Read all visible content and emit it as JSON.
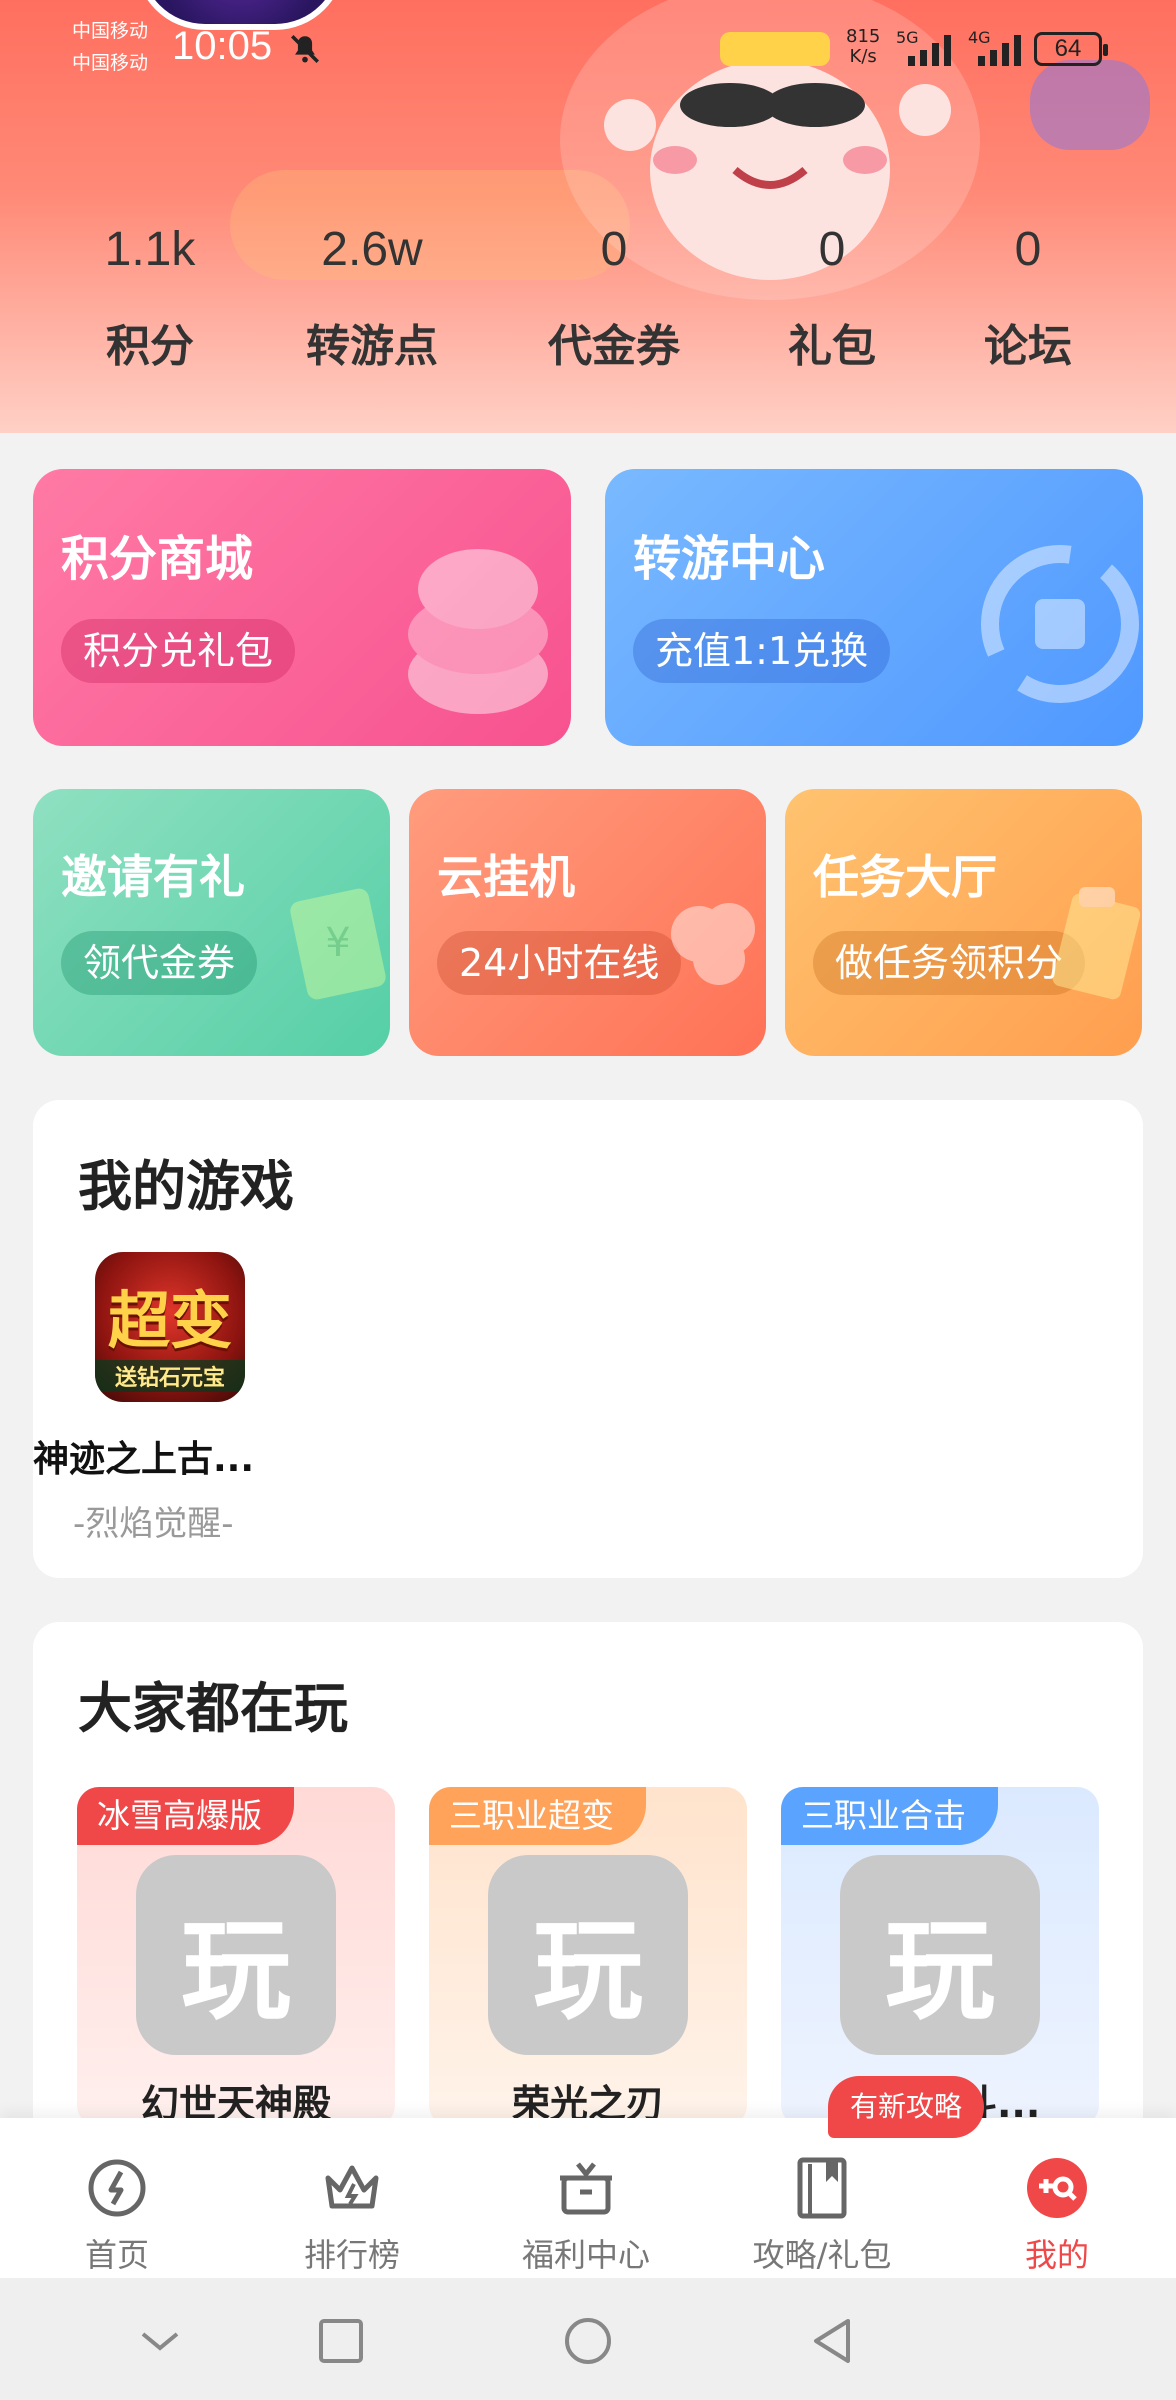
{
  "status_bar": {
    "carrier_1": "中国移动",
    "carrier_2": "中国移动",
    "time": "10:05",
    "net_speed_value": "815",
    "net_speed_unit": "K/s",
    "sig_5g": "5G",
    "sig_4g": "4G",
    "battery": "64",
    "icons": [
      "bell-off-icon",
      "signal-icon",
      "battery-icon"
    ]
  },
  "stats": [
    {
      "value": "1.1k",
      "label": "积分"
    },
    {
      "value": "2.6w",
      "label": "转游点"
    },
    {
      "value": "0",
      "label": "代金券"
    },
    {
      "value": "0",
      "label": "礼包"
    },
    {
      "value": "0",
      "label": "论坛"
    }
  ],
  "feature_cards": {
    "points_mall": {
      "title": "积分商城",
      "subtitle": "积分兑礼包",
      "icon": "coins-icon",
      "color": "#f7528f"
    },
    "transfer_center": {
      "title": "转游中心",
      "subtitle": "充值1:1兑换",
      "icon": "exchange-icon",
      "color": "#5aa3ff"
    },
    "invite": {
      "title": "邀请有礼",
      "subtitle": "领代金券",
      "icon": "voucher-icon",
      "color": "#5fd3ae"
    },
    "cloud_idle": {
      "title": "云挂机",
      "subtitle": "24小时在线",
      "icon": "cloud-icon",
      "color": "#ff7a63"
    },
    "task_hall": {
      "title": "任务大厅",
      "subtitle": "做任务领积分",
      "icon": "task-icon",
      "color": "#ffa75a"
    }
  },
  "my_games": {
    "title": "我的游戏",
    "games": [
      {
        "name": "神迹之上古...",
        "subtitle": "-烈焰觉醒-",
        "icon_text": "超变",
        "icon_sub": "送钻石元宝"
      }
    ]
  },
  "everyone_playing": {
    "title": "大家都在玩",
    "games": [
      {
        "tag": "冰雪高爆版",
        "name": "幻世天神殿",
        "icon_text": "玩",
        "tag_color": "#f04848"
      },
      {
        "tag": "三职业超变",
        "name": "荣光之刃",
        "icon_text": "玩",
        "tag_color": "#ffa25a"
      },
      {
        "tag": "三职业合击",
        "name": "约...（斗...",
        "icon_text": "玩",
        "tag_color": "#5aa3ff"
      }
    ]
  },
  "guide_badge": "有新攻略",
  "bottom_nav": [
    {
      "label": "首页",
      "icon": "home-icon"
    },
    {
      "label": "排行榜",
      "icon": "crown-icon"
    },
    {
      "label": "福利中心",
      "icon": "gift-icon"
    },
    {
      "label": "攻略/礼包",
      "icon": "book-icon"
    },
    {
      "label": "我的",
      "icon": "profile-icon",
      "active": true
    }
  ],
  "colors": {
    "accent": "#f04848",
    "header_top": "#ff6f5f"
  }
}
